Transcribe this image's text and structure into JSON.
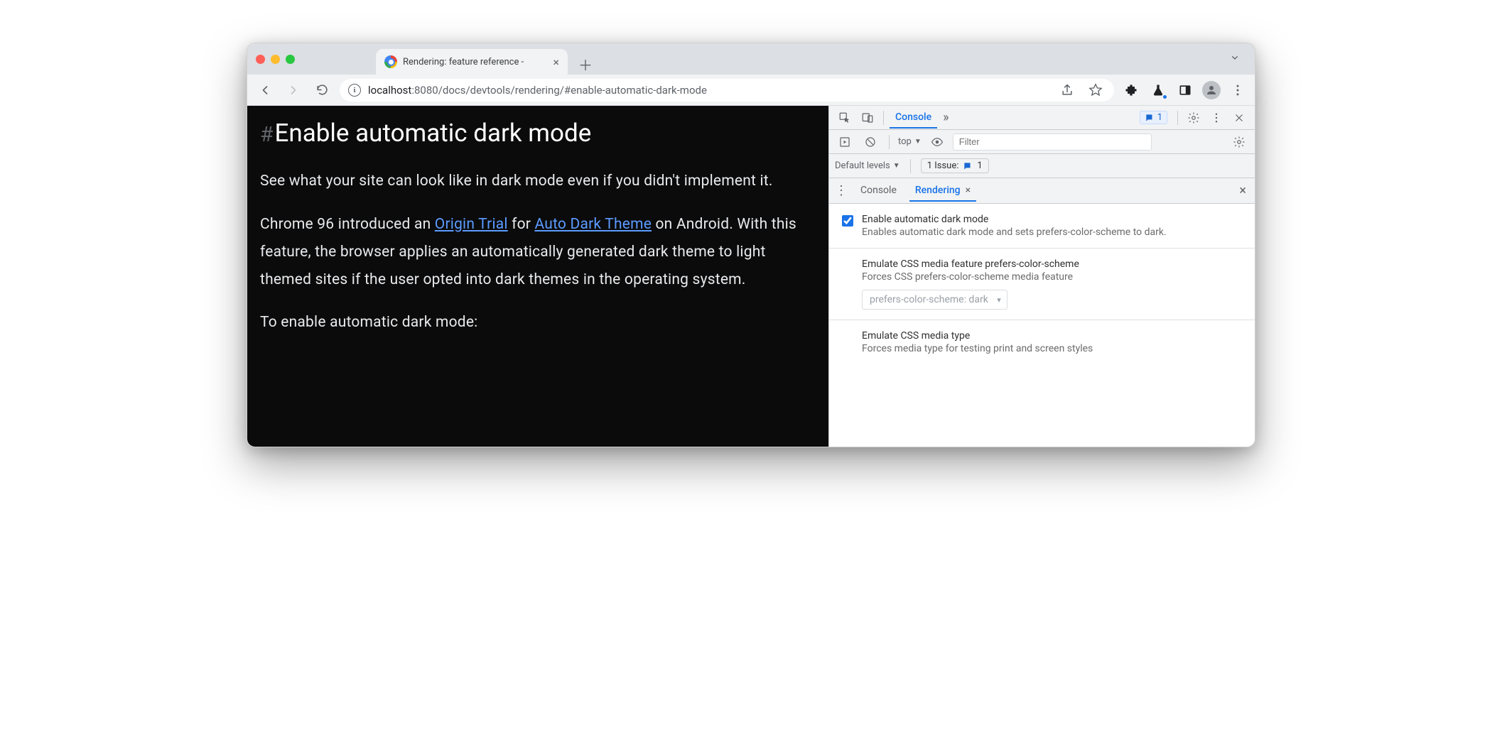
{
  "tab": {
    "title": "Rendering: feature reference - "
  },
  "url": {
    "host": "localhost",
    "port": ":8080",
    "path": "/docs/devtools/rendering/#enable-automatic-dark-mode"
  },
  "page": {
    "heading": "Enable automatic dark mode",
    "p1": "See what your site can look like in dark mode even if you didn't implement it.",
    "p2a": "Chrome 96 introduced an ",
    "link1": "Origin Trial",
    "p2b": " for ",
    "link2": "Auto Dark Theme",
    "p2c": " on Android. With this feature, the browser applies an automatically generated dark theme to light themed sites if the user opted into dark themes in the operating system.",
    "p3": "To enable automatic dark mode:"
  },
  "devtools": {
    "tab_console": "Console",
    "issues_count": "1",
    "scope_label": "top",
    "filter_placeholder": "Filter",
    "levels_label": "Default levels",
    "issue_label": "1 Issue:",
    "issue_count2": "1",
    "drawer_console": "Console",
    "drawer_rendering": "Rendering",
    "opt1_title": "Enable automatic dark mode",
    "opt1_desc": "Enables automatic dark mode and sets prefers-color-scheme to dark.",
    "opt2_title": "Emulate CSS media feature prefers-color-scheme",
    "opt2_desc": "Forces CSS prefers-color-scheme media feature",
    "opt2_select": "prefers-color-scheme: dark",
    "opt3_title": "Emulate CSS media type",
    "opt3_desc": "Forces media type for testing print and screen styles"
  }
}
